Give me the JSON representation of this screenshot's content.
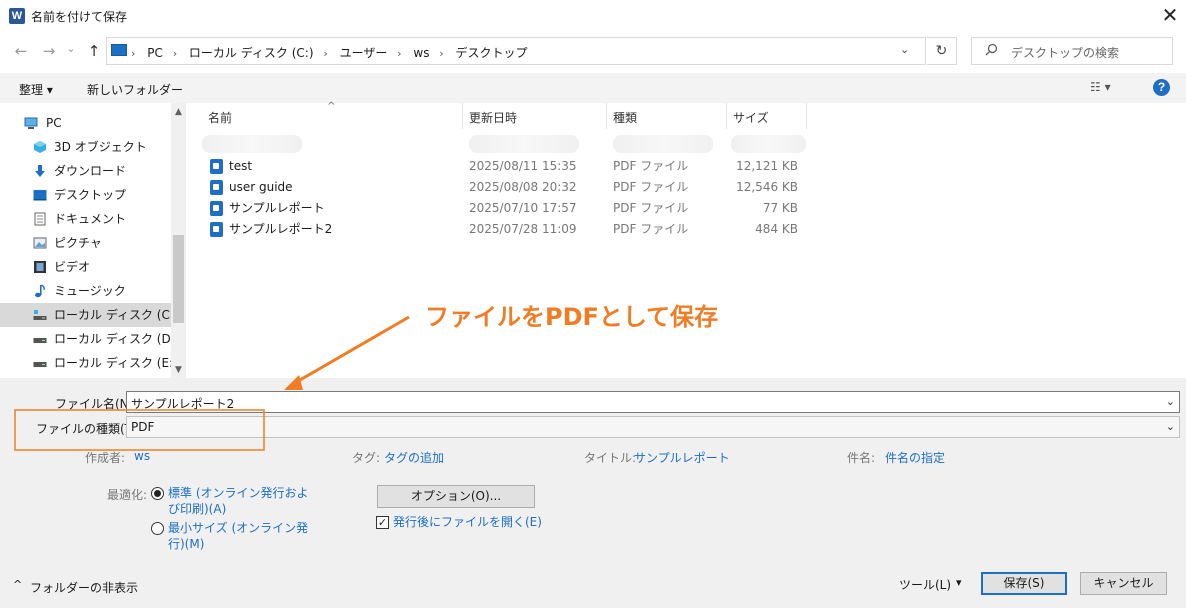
{
  "window": {
    "app_icon": "W",
    "title": "名前を付けて保存",
    "close": "✕"
  },
  "nav": {
    "back": "←",
    "forward": "→",
    "recent": "⌄",
    "up": "↑"
  },
  "address": {
    "crumbs": [
      "PC",
      "ローカル ディスク (C:)",
      "ユーザー",
      "ws",
      "デスクトップ"
    ],
    "separator": "›",
    "dropdown": "⌄",
    "refresh": "↻"
  },
  "search": {
    "placeholder": "デスクトップの検索",
    "icon": "search-icon"
  },
  "toolbar": {
    "organize": "整理 ▾",
    "new_folder": "新しいフォルダー",
    "view": "☷ ▾",
    "help": "?"
  },
  "sidebar": {
    "items": [
      {
        "label": "PC",
        "icon": "pc-icon"
      },
      {
        "label": "3D オブジェクト",
        "icon": "3d-objects-icon"
      },
      {
        "label": "ダウンロード",
        "icon": "download-icon"
      },
      {
        "label": "デスクトップ",
        "icon": "desktop-icon"
      },
      {
        "label": "ドキュメント",
        "icon": "document-icon"
      },
      {
        "label": "ピクチャ",
        "icon": "picture-icon"
      },
      {
        "label": "ビデオ",
        "icon": "video-icon"
      },
      {
        "label": "ミュージック",
        "icon": "music-icon"
      },
      {
        "label": "ローカル ディスク (C:)",
        "icon": "drive-icon",
        "selected": true
      },
      {
        "label": "ローカル ディスク (D:)",
        "icon": "drive-icon"
      },
      {
        "label": "ローカル ディスク (E:)",
        "icon": "drive-icon"
      }
    ],
    "scroll_up": "▲",
    "scroll_down": "▼"
  },
  "filelist": {
    "columns": [
      "名前",
      "更新日時",
      "種類",
      "サイズ"
    ],
    "sort_caret": "^",
    "rows": [
      {
        "name": "test",
        "date": "2025/08/11 15:35",
        "type": "PDF ファイル",
        "size": "12,121 KB"
      },
      {
        "name": "user guide",
        "date": "2025/08/08 20:32",
        "type": "PDF ファイル",
        "size": "12,546 KB"
      },
      {
        "name": "サンプルレポート",
        "date": "2025/07/10 17:57",
        "type": "PDF ファイル",
        "size": "77 KB"
      },
      {
        "name": "サンプルレポート2",
        "date": "2025/07/28 11:09",
        "type": "PDF ファイル",
        "size": "484 KB"
      }
    ]
  },
  "annotation": {
    "text": "ファイルをPDFとして保存",
    "color": "#f07d25"
  },
  "form": {
    "filename_label": "ファイル名(N):",
    "filename_value": "サンプルレポート2",
    "filetype_label": "ファイルの種類(T):",
    "filetype_value": "PDF",
    "dropdown": "⌄",
    "author_label": "作成者:",
    "author_value": "ws",
    "tags_label": "タグ:",
    "tags_value": "タグの追加",
    "title_label": "タイトル:",
    "title_value": "サンプルレポート",
    "subject_label": "件名:",
    "subject_value": "件名の指定",
    "optimize_label": "最適化:",
    "opt_standard_1": "標準 (オンライン発行およ",
    "opt_standard_2": "び印刷)(A)",
    "opt_minimum_1": "最小サイズ (オンライン発",
    "opt_minimum_2": "行)(M)",
    "options_button": "オプション(O)...",
    "open_after_check": "✓",
    "open_after_label": "発行後にファイルを開く(E)",
    "hide_folders": "フォルダーの非表示",
    "hide_folders_caret": "^",
    "tools": "ツール(L)",
    "tools_caret": "▾",
    "save": "保存(S)",
    "cancel": "キャンセル"
  },
  "colors": {
    "accent": "#1e6fc4",
    "annotation": "#f07d25",
    "selected_row": "#d9d9d9"
  }
}
